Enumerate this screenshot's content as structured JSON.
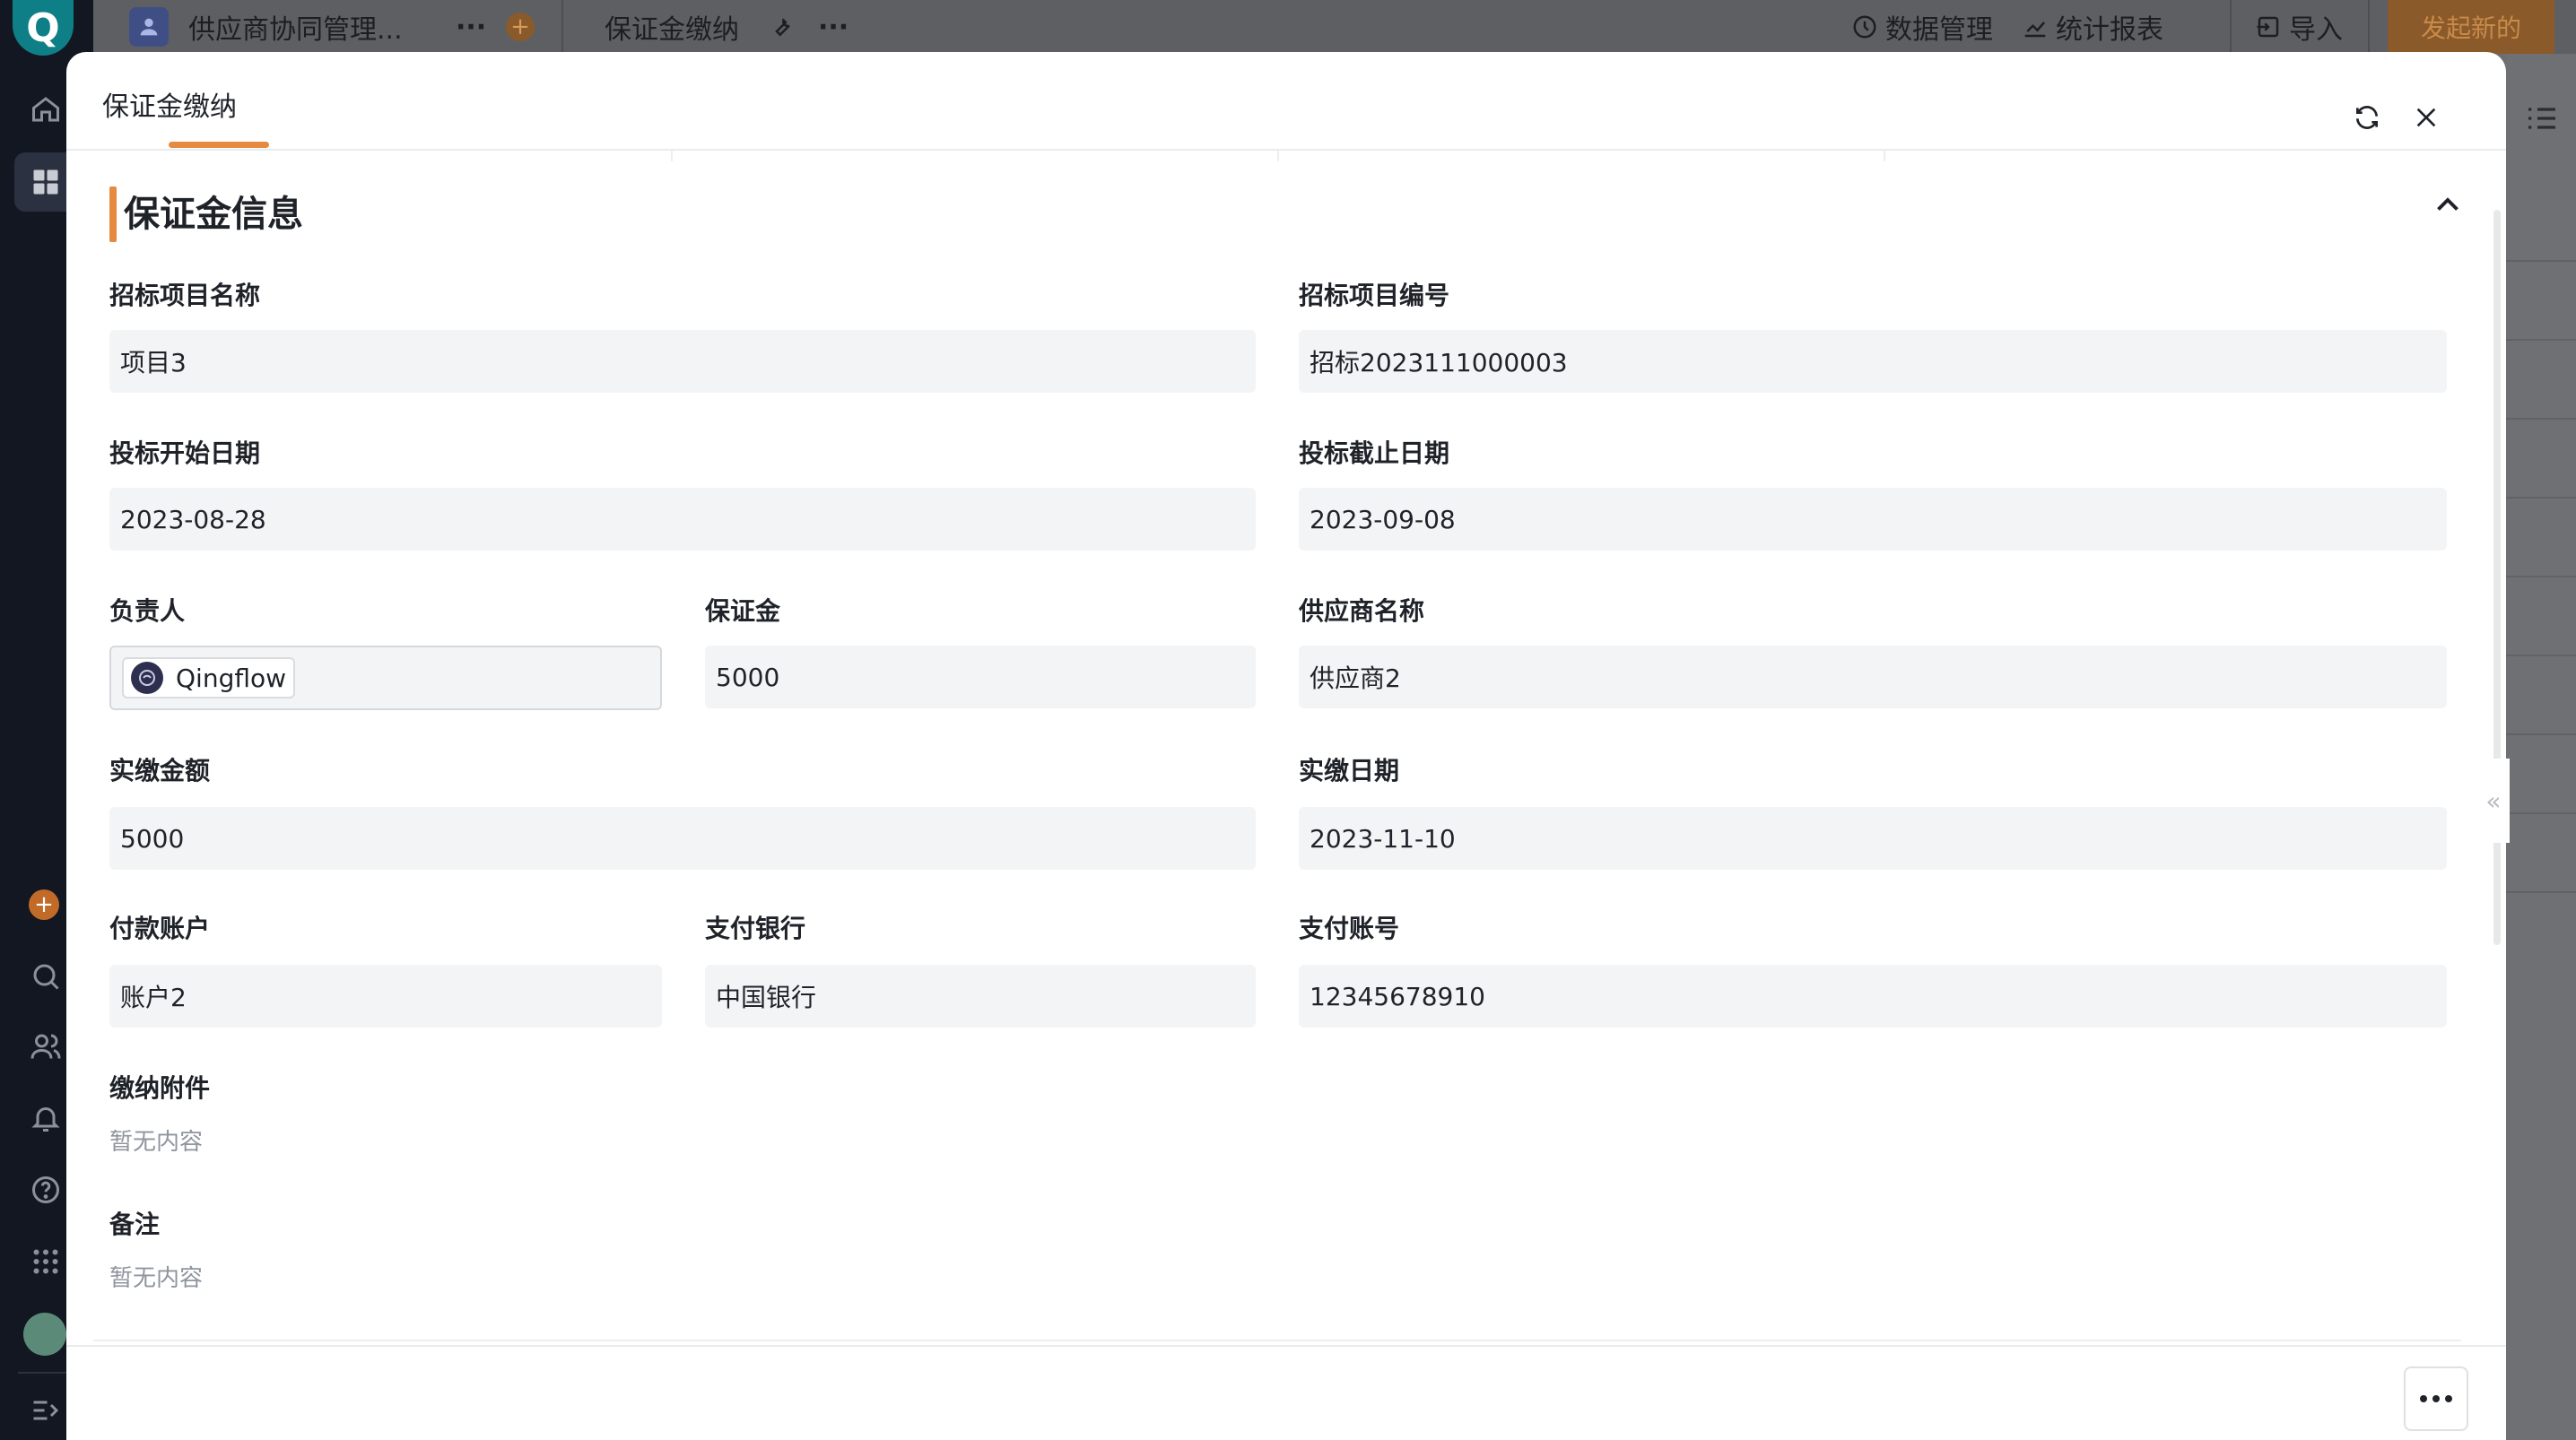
{
  "topbar": {
    "app_name": "供应商协同管理...",
    "page_name": "保证金缴纳",
    "data_manage": "数据管理",
    "stats_report": "统计报表",
    "import": "导入",
    "new_button": "发起新的"
  },
  "modal": {
    "title": "保证金缴纳",
    "section_title": "保证金信息",
    "fields": {
      "project_name": {
        "label": "招标项目名称",
        "value": "项目3"
      },
      "project_code": {
        "label": "招标项目编号",
        "value": "招标2023111000003"
      },
      "bid_start": {
        "label": "投标开始日期",
        "value": "2023-08-28"
      },
      "bid_end": {
        "label": "投标截止日期",
        "value": "2023-09-08"
      },
      "owner": {
        "label": "负责人",
        "value": "Qingflow"
      },
      "deposit": {
        "label": "保证金",
        "value": "5000"
      },
      "supplier": {
        "label": "供应商名称",
        "value": "供应商2"
      },
      "paid_amount": {
        "label": "实缴金额",
        "value": "5000"
      },
      "paid_date": {
        "label": "实缴日期",
        "value": "2023-11-10"
      },
      "pay_account": {
        "label": "付款账户",
        "value": "账户2"
      },
      "pay_bank": {
        "label": "支付银行",
        "value": "中国银行"
      },
      "pay_account_no": {
        "label": "支付账号",
        "value": "12345678910"
      },
      "attachment": {
        "label": "缴纳附件",
        "value": "暂无内容"
      },
      "remark": {
        "label": "备注",
        "value": "暂无内容"
      }
    }
  },
  "colors": {
    "accent": "#e58a3e",
    "field_bg": "#f3f4f5"
  }
}
